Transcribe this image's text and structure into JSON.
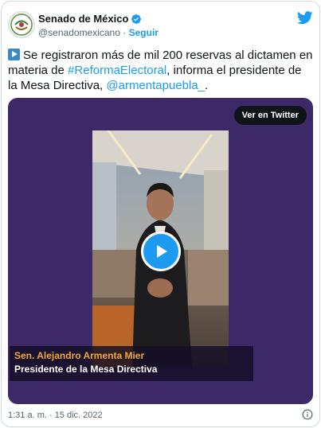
{
  "account": {
    "name": "Senado de México",
    "handle": "@senadomexicano",
    "separator": "·",
    "follow_label": "Seguir"
  },
  "tweet": {
    "text_before": "Se registraron más de mil 200 reservas al dictamen en materia de ",
    "hashtag": "#ReformaElectoral",
    "text_middle": ", informa el presidente de la Mesa Directiva, ",
    "mention": "@armentapuebla_",
    "text_after": "."
  },
  "media": {
    "watch_label": "Ver en Twitter",
    "caption_name": "Sen. Alejandro Armenta Mier",
    "caption_title": "Presidente de la Mesa Directiva"
  },
  "footer": {
    "timestamp": "1:31 a. m. · 15 dic. 2022"
  },
  "icons": {
    "avatar": "senado-seal-icon",
    "verified": "verified-badge-icon",
    "brand": "twitter-bird-icon",
    "play": "play-icon",
    "info": "info-icon"
  },
  "colors": {
    "link": "#1d9bf0",
    "media_background": "#3d2968",
    "caption_name": "#f0a830",
    "text": "#0f1419",
    "muted": "#536471"
  }
}
